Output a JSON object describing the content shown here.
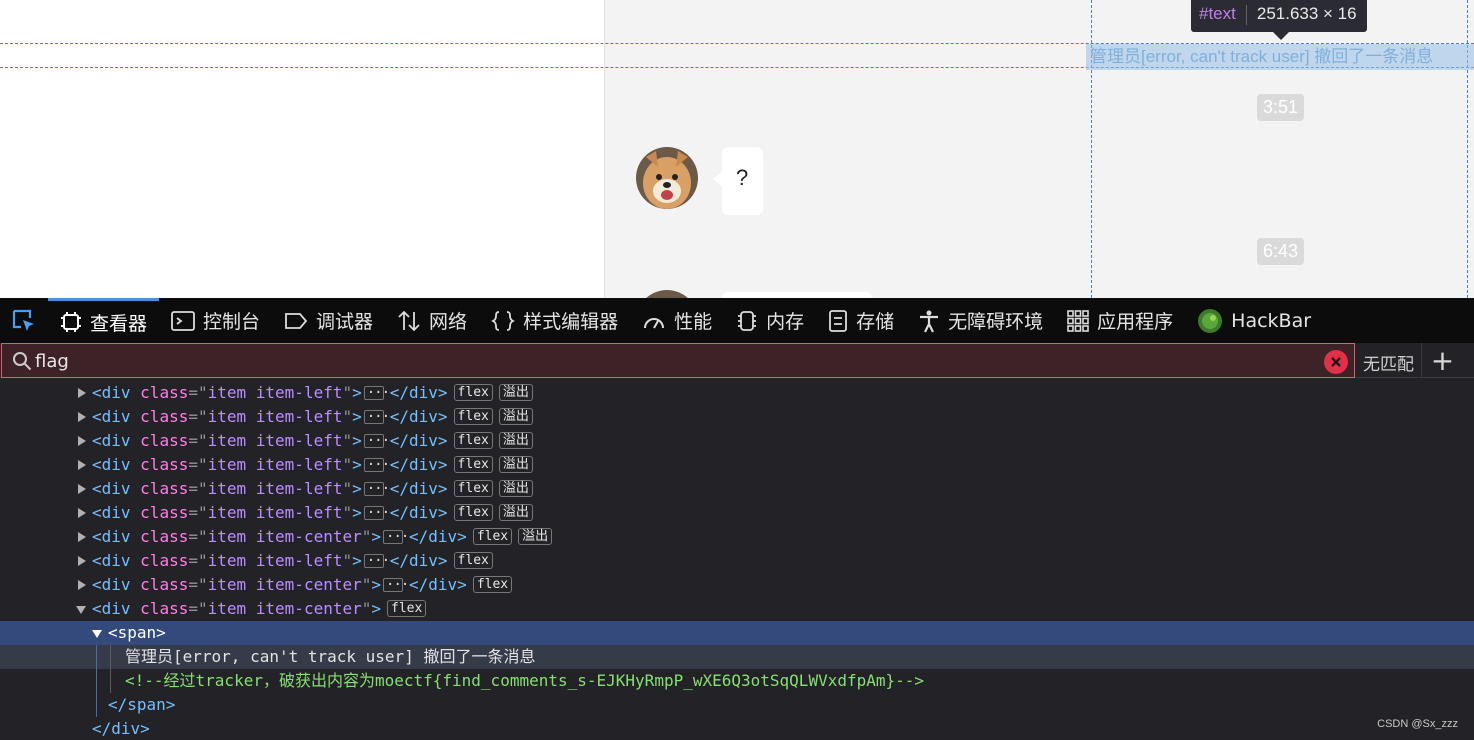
{
  "page": {
    "times": [
      "3:51",
      "6:43"
    ],
    "bubble_text": "?",
    "highlight_text": "管理员[error, can't track user] 撤回了一条消息",
    "tooltip": {
      "tag": "#text",
      "size": "251.633 × 16"
    }
  },
  "devtools": {
    "tabs": [
      {
        "label": "查看器",
        "icon": "inspector-icon",
        "active": true
      },
      {
        "label": "控制台",
        "icon": "console-icon"
      },
      {
        "label": "调试器",
        "icon": "debugger-icon"
      },
      {
        "label": "网络",
        "icon": "network-icon"
      },
      {
        "label": "样式编辑器",
        "icon": "style-editor-icon"
      },
      {
        "label": "性能",
        "icon": "performance-icon"
      },
      {
        "label": "内存",
        "icon": "memory-icon"
      },
      {
        "label": "存储",
        "icon": "storage-icon"
      },
      {
        "label": "无障碍环境",
        "icon": "accessibility-icon"
      },
      {
        "label": "应用程序",
        "icon": "application-icon"
      },
      {
        "label": "HackBar",
        "icon": "hackbar-icon"
      }
    ],
    "search": {
      "value": "flag",
      "status": "无匹配",
      "add": "+"
    },
    "tree": {
      "rows": [
        {
          "cls": "item item-left",
          "badges": [
            "flex",
            "溢出"
          ]
        },
        {
          "cls": "item item-left",
          "badges": [
            "flex",
            "溢出"
          ]
        },
        {
          "cls": "item item-left",
          "badges": [
            "flex",
            "溢出"
          ]
        },
        {
          "cls": "item item-left",
          "badges": [
            "flex",
            "溢出"
          ]
        },
        {
          "cls": "item item-left",
          "badges": [
            "flex",
            "溢出"
          ]
        },
        {
          "cls": "item item-left",
          "badges": [
            "flex",
            "溢出"
          ]
        },
        {
          "cls": "item item-center",
          "badges": [
            "flex",
            "溢出"
          ]
        },
        {
          "cls": "item item-left",
          "badges": [
            "flex"
          ]
        },
        {
          "cls": "item item-center",
          "badges": [
            "flex"
          ]
        }
      ],
      "open_row": {
        "cls": "item item-center",
        "badge": "flex"
      },
      "span_open": "<span>",
      "text_node": "管理员[error, can't track user] 撤回了一条消息",
      "comment": "<!--经过tracker，破获出内容为moectf{find_comments_s-EJKHyRmpP_wXE6Q3otSqQLWVxdfpAm}-->",
      "span_close": "</span>",
      "div_close": "</div>"
    }
  },
  "watermark": "CSDN @Sx_zzz"
}
